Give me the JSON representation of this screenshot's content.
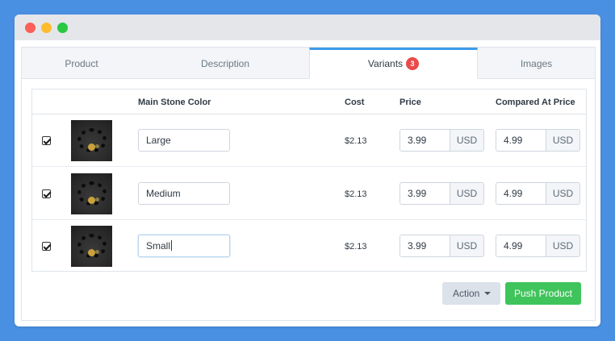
{
  "window": {
    "controls": [
      "close",
      "minimize",
      "maximize"
    ]
  },
  "tabs": [
    {
      "label": "Product",
      "active": false
    },
    {
      "label": "Description",
      "active": false
    },
    {
      "label": "Variants",
      "active": true,
      "badge": "3"
    },
    {
      "label": "Images",
      "active": false
    }
  ],
  "table": {
    "columns": {
      "stone_color": "Main Stone Color",
      "cost": "Cost",
      "price": "Price",
      "compared": "Compared At Price"
    },
    "rows": [
      {
        "checked": true,
        "stone_color": "Large",
        "cost": "$2.13",
        "price": "3.99",
        "price_currency": "USD",
        "compared": "4.99",
        "compared_currency": "USD"
      },
      {
        "checked": true,
        "stone_color": "Medium",
        "cost": "$2.13",
        "price": "3.99",
        "price_currency": "USD",
        "compared": "4.99",
        "compared_currency": "USD"
      },
      {
        "checked": true,
        "stone_color": "Small",
        "cost": "$2.13",
        "price": "3.99",
        "price_currency": "USD",
        "compared": "4.99",
        "compared_currency": "USD"
      }
    ]
  },
  "buttons": {
    "action": "Action",
    "push": "Push Product"
  },
  "colors": {
    "background": "#4a90e2",
    "accent_tab": "#3d9be9",
    "badge": "#e94b4b",
    "push": "#3fc45b"
  },
  "icons": [
    "close-dot-icon",
    "minimize-dot-icon",
    "maximize-dot-icon",
    "checkbox-checked-icon",
    "chevron-down-icon",
    "bracelet-thumbnail"
  ]
}
